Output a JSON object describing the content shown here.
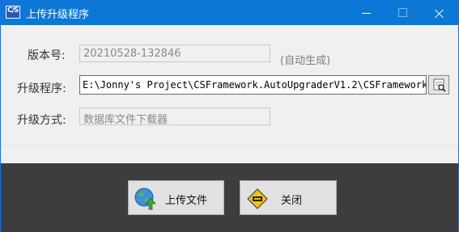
{
  "window": {
    "title": "上传升级程序"
  },
  "form": {
    "version_label": "版本号:",
    "version_value": "20210528-132846",
    "version_hint": "(自动生成)",
    "program_label": "升级程序:",
    "program_value": "E:\\Jonny's Project\\CSFramework.AutoUpgraderV1.2\\CSFramework..",
    "method_label": "升级方式:",
    "method_value": "数据库文件下载器"
  },
  "buttons": {
    "upload_label": "上传文件",
    "close_label": "关闭"
  },
  "app_icon_text": "C/S"
}
